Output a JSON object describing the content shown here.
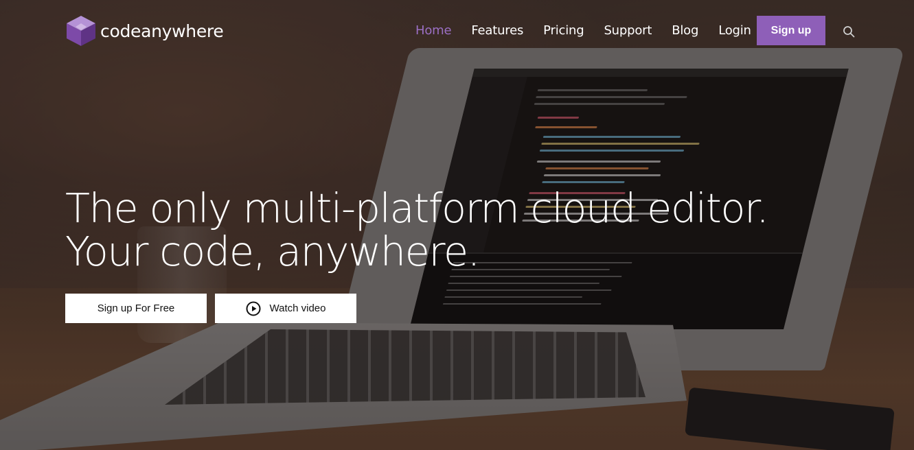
{
  "brand": {
    "name": "codeanywhere",
    "accent_color": "#8e5fb8",
    "logo_icon": "cube-icon"
  },
  "nav": {
    "items": [
      {
        "label": "Home",
        "active": true
      },
      {
        "label": "Features",
        "active": false
      },
      {
        "label": "Pricing",
        "active": false
      },
      {
        "label": "Support",
        "active": false
      },
      {
        "label": "Blog",
        "active": false
      },
      {
        "label": "Login",
        "active": false
      }
    ],
    "signup_label": "Sign up",
    "search_icon": "search-icon"
  },
  "hero": {
    "line1": "The only multi-platform cloud editor.",
    "line2": "Your code, anywhere.",
    "primary_cta": "Sign up For Free",
    "secondary_cta": "Watch video",
    "secondary_icon": "play-icon"
  }
}
